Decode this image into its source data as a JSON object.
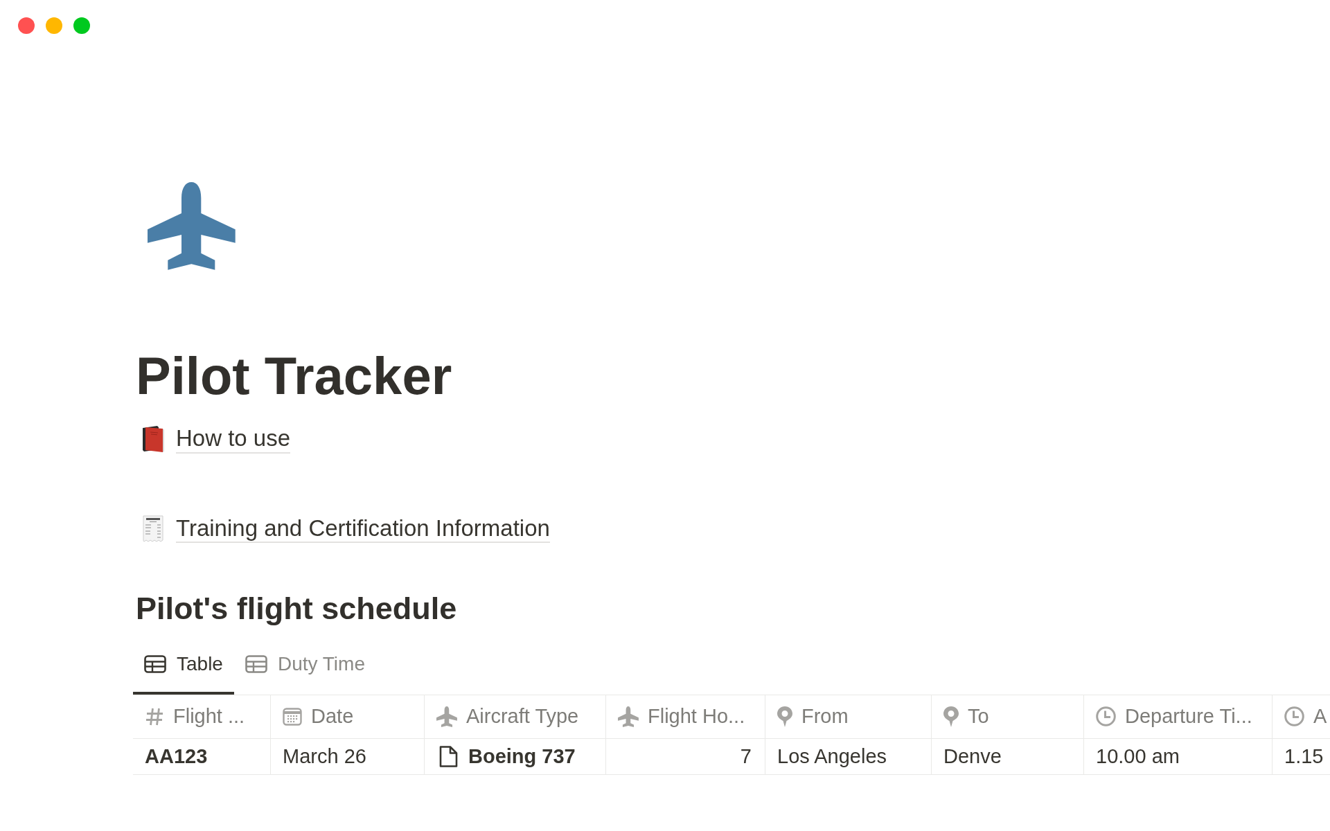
{
  "page": {
    "title": "Pilot Tracker",
    "links": [
      {
        "kind": "book",
        "label": "How to use"
      },
      {
        "kind": "receipt",
        "label": "Training and Certification Information"
      }
    ]
  },
  "database": {
    "title": "Pilot's flight schedule",
    "tabs": [
      {
        "label": "Table",
        "selected": true
      },
      {
        "label": "Duty Time",
        "selected": false
      }
    ],
    "table": {
      "columns": [
        {
          "kind": "hash",
          "label": "Flight ..."
        },
        {
          "kind": "calendar",
          "label": "Date"
        },
        {
          "kind": "plane",
          "label": "Aircraft Type"
        },
        {
          "kind": "plane",
          "label": "Flight Ho..."
        },
        {
          "kind": "pin",
          "label": "From"
        },
        {
          "kind": "pin",
          "label": "To"
        },
        {
          "kind": "clock",
          "label": "Departure Ti..."
        },
        {
          "kind": "clock",
          "label": "A"
        }
      ],
      "rows": [
        {
          "cells": [
            {
              "kind": "title",
              "text": "AA123"
            },
            {
              "kind": "text",
              "text": "March 26"
            },
            {
              "kind": "relation",
              "text": "Boeing 737"
            },
            {
              "kind": "number",
              "text": "7"
            },
            {
              "kind": "text",
              "text": "Los Angeles"
            },
            {
              "kind": "text",
              "text": "Denve"
            },
            {
              "kind": "text",
              "text": "10.00 am"
            },
            {
              "kind": "text",
              "text": "1.15"
            }
          ]
        }
      ]
    }
  }
}
